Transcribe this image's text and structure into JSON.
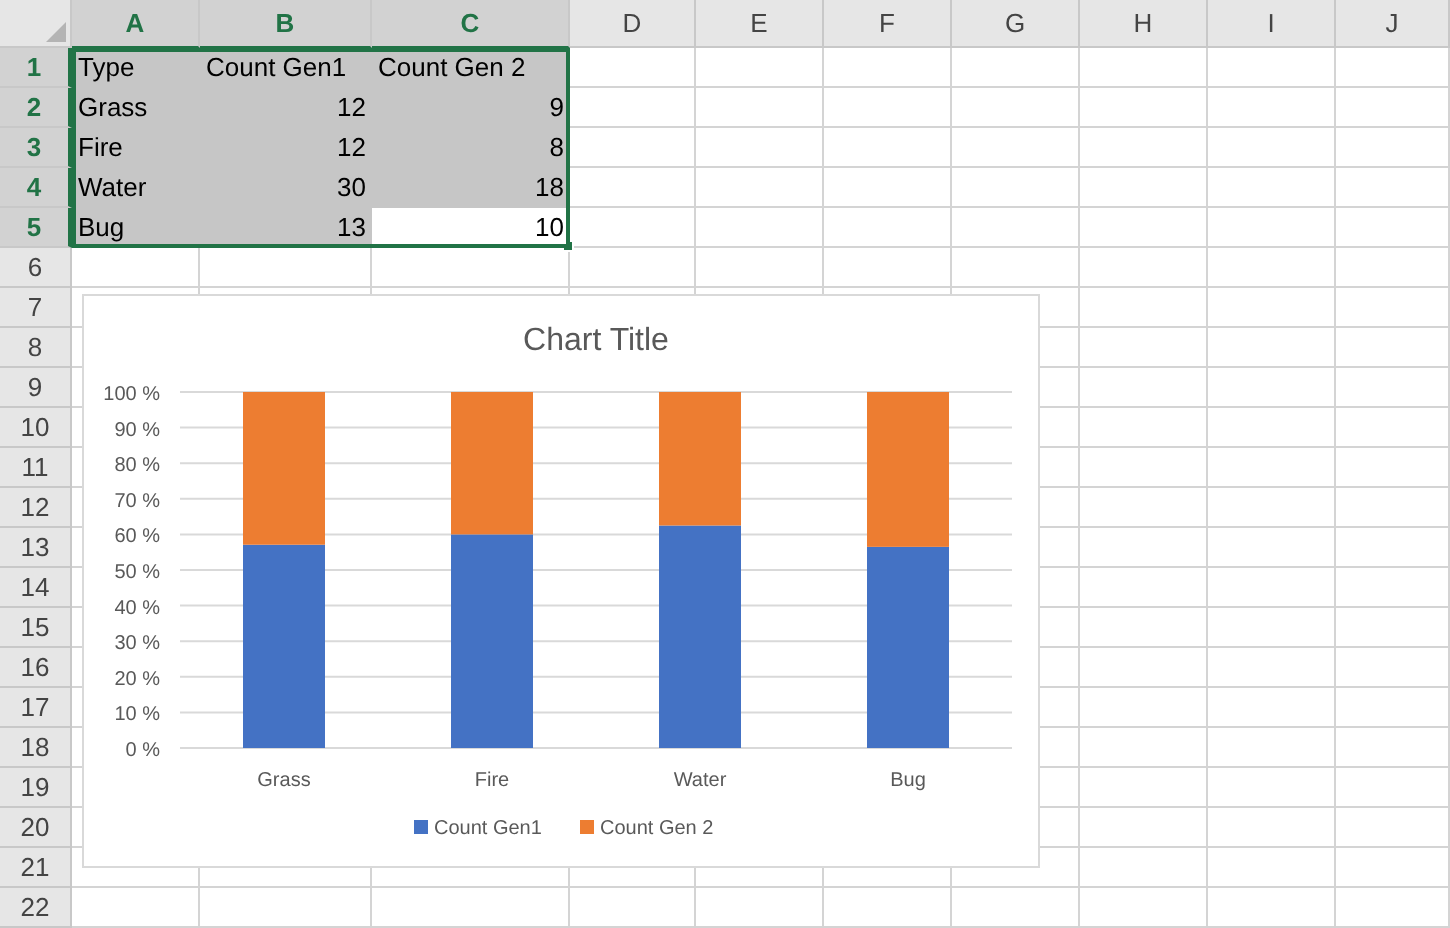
{
  "sheet": {
    "columns": [
      {
        "label": "A",
        "selected": true
      },
      {
        "label": "B",
        "selected": true
      },
      {
        "label": "C",
        "selected": true
      },
      {
        "label": "D",
        "selected": false
      },
      {
        "label": "E",
        "selected": false
      },
      {
        "label": "F",
        "selected": false
      },
      {
        "label": "G",
        "selected": false
      },
      {
        "label": "H",
        "selected": false
      },
      {
        "label": "I",
        "selected": false
      },
      {
        "label": "J",
        "selected": false
      }
    ],
    "rows": [
      {
        "label": "1",
        "selected": true,
        "cells": [
          {
            "text": "Type",
            "kind": "text",
            "selected": true,
            "active": false
          },
          {
            "text": "Count Gen1",
            "kind": "text",
            "selected": true,
            "active": false
          },
          {
            "text": "Count Gen 2",
            "kind": "text",
            "selected": true,
            "active": false
          }
        ]
      },
      {
        "label": "2",
        "selected": true,
        "cells": [
          {
            "text": "Grass",
            "kind": "text",
            "selected": true,
            "active": false
          },
          {
            "text": "12",
            "kind": "number",
            "selected": true,
            "active": false
          },
          {
            "text": "9",
            "kind": "number",
            "selected": true,
            "active": false
          }
        ]
      },
      {
        "label": "3",
        "selected": true,
        "cells": [
          {
            "text": "Fire",
            "kind": "text",
            "selected": true,
            "active": false
          },
          {
            "text": "12",
            "kind": "number",
            "selected": true,
            "active": false
          },
          {
            "text": "8",
            "kind": "number",
            "selected": true,
            "active": false
          }
        ]
      },
      {
        "label": "4",
        "selected": true,
        "cells": [
          {
            "text": "Water",
            "kind": "text",
            "selected": true,
            "active": false
          },
          {
            "text": "30",
            "kind": "number",
            "selected": true,
            "active": false
          },
          {
            "text": "18",
            "kind": "number",
            "selected": true,
            "active": false
          }
        ]
      },
      {
        "label": "5",
        "selected": true,
        "cells": [
          {
            "text": "Bug",
            "kind": "text",
            "selected": true,
            "active": false
          },
          {
            "text": "13",
            "kind": "number",
            "selected": true,
            "active": false
          },
          {
            "text": "10",
            "kind": "number",
            "selected": true,
            "active": true
          }
        ]
      },
      {
        "label": "6",
        "selected": false
      },
      {
        "label": "7",
        "selected": false
      },
      {
        "label": "8",
        "selected": false
      },
      {
        "label": "9",
        "selected": false
      },
      {
        "label": "10",
        "selected": false
      },
      {
        "label": "11",
        "selected": false
      },
      {
        "label": "12",
        "selected": false
      },
      {
        "label": "13",
        "selected": false
      },
      {
        "label": "14",
        "selected": false
      },
      {
        "label": "15",
        "selected": false
      },
      {
        "label": "16",
        "selected": false
      },
      {
        "label": "17",
        "selected": false
      },
      {
        "label": "18",
        "selected": false
      },
      {
        "label": "19",
        "selected": false
      },
      {
        "label": "20",
        "selected": false
      },
      {
        "label": "21",
        "selected": false
      },
      {
        "label": "22",
        "selected": false
      }
    ]
  },
  "chart": {
    "chart_data": {
      "type": "bar",
      "title": "Chart Title",
      "stacked": true,
      "categories": [
        "Grass",
        "Fire",
        "Water",
        "Bug"
      ],
      "series": [
        {
          "name": "Count Gen1",
          "color": "#4472c4",
          "values": [
            0.571,
            0.6,
            0.625,
            0.565
          ]
        },
        {
          "name": "Count Gen 2",
          "color": "#ed7d31",
          "values": [
            0.429,
            0.4,
            0.375,
            0.435
          ]
        }
      ],
      "ylim": [
        0,
        1
      ],
      "grid": true,
      "legend": true,
      "yticks": [
        {
          "value": 0,
          "label": "0 %"
        },
        {
          "value": 0.1,
          "label": "10 %"
        },
        {
          "value": 0.2,
          "label": "20 %"
        },
        {
          "value": 0.3,
          "label": "30 %"
        },
        {
          "value": 0.4,
          "label": "40 %"
        },
        {
          "value": 0.5,
          "label": "50 %"
        },
        {
          "value": 0.6,
          "label": "60 %"
        },
        {
          "value": 0.7,
          "label": "70 %"
        },
        {
          "value": 0.8,
          "label": "80 %"
        },
        {
          "value": 0.9,
          "label": "90 %"
        },
        {
          "value": 1,
          "label": "100 %"
        }
      ]
    }
  }
}
